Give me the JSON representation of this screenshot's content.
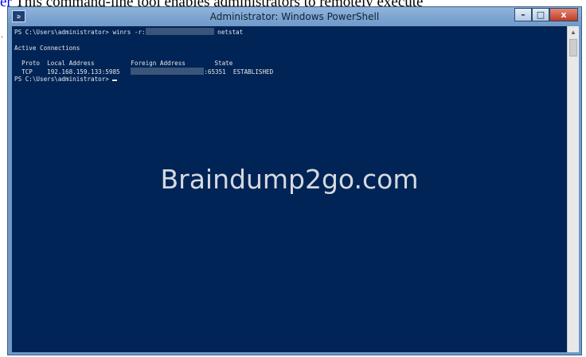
{
  "doc": {
    "link_text": "er",
    "rest_text": " This command-line tool enables administrators to remotely execute",
    "bullet": "."
  },
  "window": {
    "title": "Administrator: Windows PowerShell",
    "icon_glyph": "≥",
    "buttons": {
      "minimize": "–",
      "maximize": "□",
      "close": "x"
    }
  },
  "console": {
    "lines": {
      "cmd_prefix": "PS C:\\Users\\administrator> winrs -r:",
      "cmd_suffix": " netstat",
      "active": "Active Connections",
      "header": "  Proto  Local Address          Foreign Address        State",
      "row_left": "  TCP    192.168.159.133:5985   ",
      "row_right": ":65351  ESTABLISHED",
      "prompt": "PS C:\\Users\\administrator> "
    },
    "colors": {
      "background": "#012456",
      "text": "#e8e8e8"
    }
  },
  "watermark": "Braindump2go.com",
  "scrollbar": {
    "up_arrow": "▲"
  },
  "icons": [
    "powershell-icon",
    "minimize-icon",
    "maximize-icon",
    "close-icon",
    "scroll-up-icon"
  ]
}
